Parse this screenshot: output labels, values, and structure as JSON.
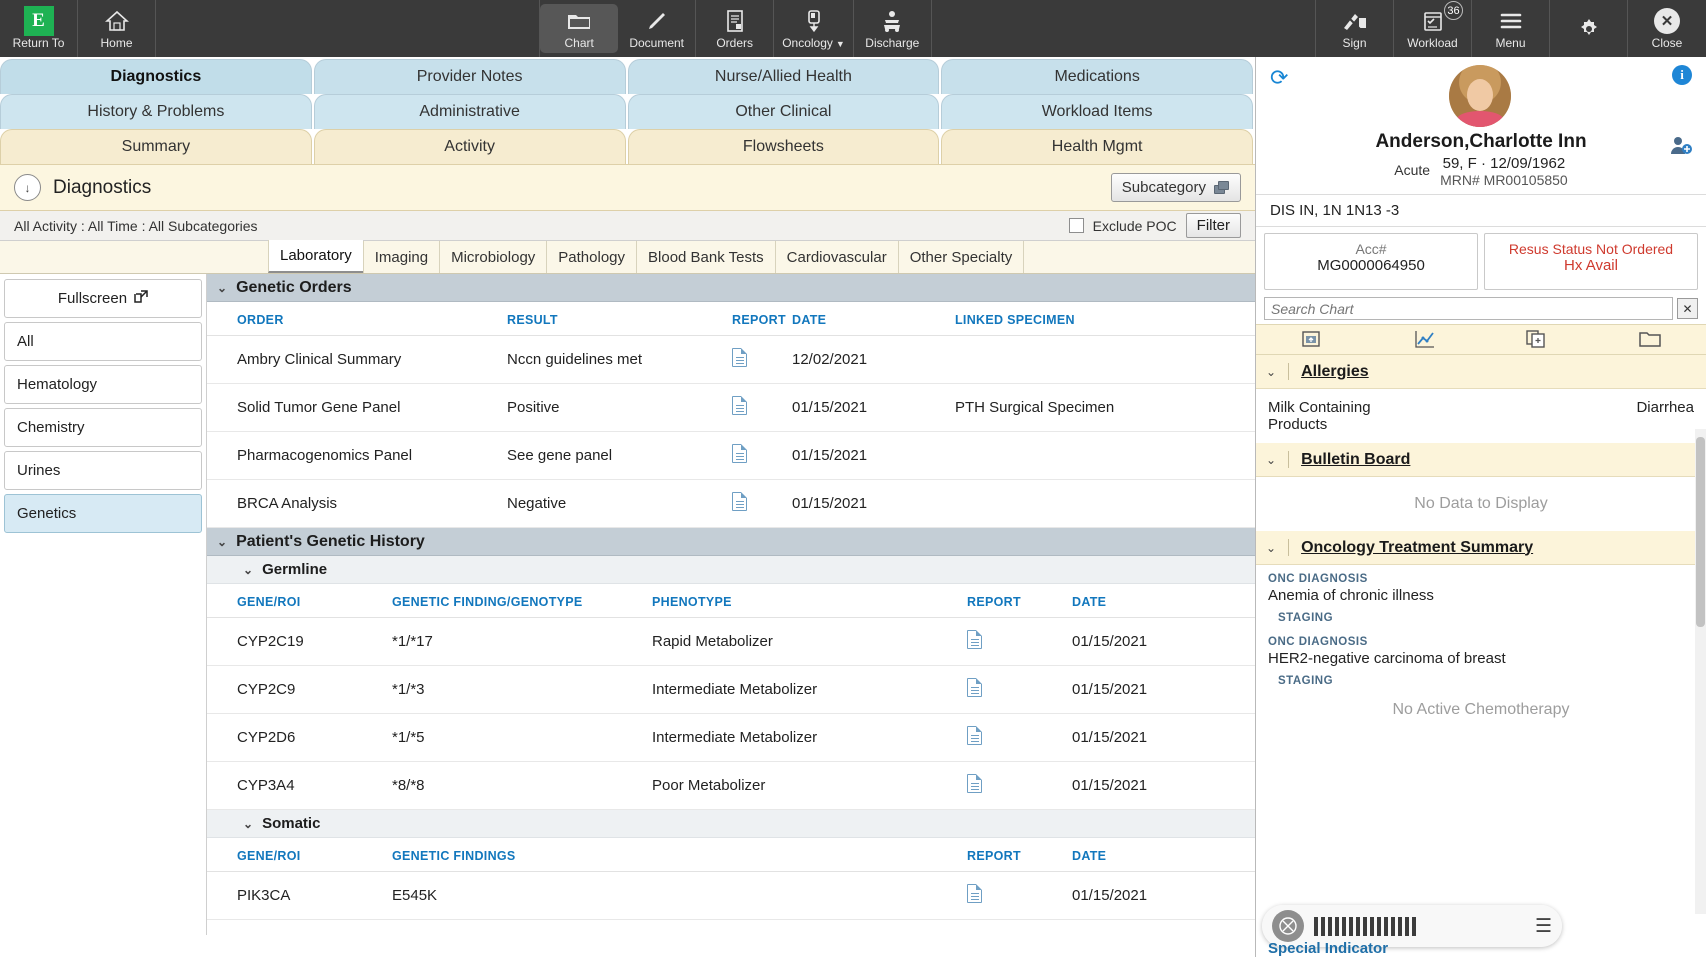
{
  "toolbar": {
    "logo_letter": "E",
    "items": [
      {
        "label": "Return To",
        "icon": "logo-icon"
      },
      {
        "label": "Home",
        "icon": "home-icon"
      },
      {
        "label": "Chart",
        "icon": "folder-icon",
        "active": true
      },
      {
        "label": "Document",
        "icon": "pencil-icon"
      },
      {
        "label": "Orders",
        "icon": "clipboard-icon"
      },
      {
        "label": "Oncology",
        "icon": "iv-bag-icon",
        "caret": true
      },
      {
        "label": "Discharge",
        "icon": "car-icon"
      },
      {
        "label": "Sign",
        "icon": "sign-icon"
      },
      {
        "label": "Workload",
        "icon": "calendar-check-icon",
        "badge": "36"
      },
      {
        "label": "Menu",
        "icon": "hamburger-icon"
      },
      {
        "label": "",
        "icon": "gear-icon"
      },
      {
        "label": "Close",
        "icon": "close-icon"
      }
    ]
  },
  "chart_tabs": {
    "row1": [
      "Diagnostics",
      "Provider Notes",
      "Nurse/Allied Health",
      "Medications"
    ],
    "row2": [
      "History & Problems",
      "Administrative",
      "Other Clinical",
      "Workload Items"
    ],
    "row3": [
      "Summary",
      "Activity",
      "Flowsheets",
      "Health Mgmt"
    ],
    "selected": "Diagnostics"
  },
  "diagnostics": {
    "title": "Diagnostics",
    "subcategory_button": "Subcategory",
    "filter_text": "All Activity  :  All Time  :  All Subcategories",
    "exclude_poc_label": "Exclude POC",
    "filter_button": "Filter"
  },
  "lab_subtabs": {
    "items": [
      "Laboratory",
      "Imaging",
      "Microbiology",
      "Pathology",
      "Blood Bank Tests",
      "Cardiovascular",
      "Other Specialty"
    ],
    "selected": "Laboratory"
  },
  "left_sidebar": {
    "fullscreen_label": "Fullscreen",
    "items": [
      "All",
      "Hematology",
      "Chemistry",
      "Urines",
      "Genetics"
    ],
    "selected": "Genetics"
  },
  "genetic_orders": {
    "section_title": "Genetic Orders",
    "columns": [
      "ORDER",
      "RESULT",
      "REPORT",
      "DATE",
      "LINKED SPECIMEN"
    ],
    "rows": [
      {
        "order": "Ambry Clinical Summary",
        "result": "Nccn guidelines met",
        "report": "document-icon",
        "date": "12/02/2021",
        "linked_specimen": ""
      },
      {
        "order": "Solid Tumor Gene Panel",
        "result": "Positive",
        "report": "document-icon",
        "date": "01/15/2021",
        "linked_specimen": "PTH Surgical Specimen"
      },
      {
        "order": "Pharmacogenomics Panel",
        "result": "See gene panel",
        "report": "document-icon",
        "date": "01/15/2021",
        "linked_specimen": ""
      },
      {
        "order": "BRCA Analysis",
        "result": "Negative",
        "report": "document-icon",
        "date": "01/15/2021",
        "linked_specimen": ""
      }
    ]
  },
  "genetic_history": {
    "section_title": "Patient's Genetic History",
    "germline": {
      "title": "Germline",
      "columns": [
        "GENE/ROI",
        "GENETIC FINDING/GENOTYPE",
        "PHENOTYPE",
        "REPORT",
        "DATE"
      ],
      "rows": [
        {
          "gene": "CYP2C19",
          "finding": "*1/*17",
          "phenotype": "Rapid Metabolizer",
          "report": "document-icon",
          "date": "01/15/2021"
        },
        {
          "gene": "CYP2C9",
          "finding": "*1/*3",
          "phenotype": "Intermediate Metabolizer",
          "report": "document-icon",
          "date": "01/15/2021"
        },
        {
          "gene": "CYP2D6",
          "finding": "*1/*5",
          "phenotype": "Intermediate Metabolizer",
          "report": "document-icon",
          "date": "01/15/2021"
        },
        {
          "gene": "CYP3A4",
          "finding": "*8/*8",
          "phenotype": "Poor Metabolizer",
          "report": "document-icon",
          "date": "01/15/2021"
        }
      ]
    },
    "somatic": {
      "title": "Somatic",
      "columns": [
        "GENE/ROI",
        "GENETIC FINDINGS",
        "REPORT",
        "DATE"
      ],
      "rows": [
        {
          "gene": "PIK3CA",
          "finding": "E545K",
          "report": "document-icon",
          "date": "01/15/2021"
        }
      ]
    }
  },
  "patient": {
    "name": "Anderson,Charlotte Inn",
    "acute_label": "Acute",
    "demographics": "59, F · 12/09/1962",
    "mrn": "MRN# MR00105850",
    "location": "DIS IN, 1N  1N13 -3",
    "acc_label": "Acc#",
    "acc_value": "MG0000064950",
    "resus_status": "Resus Status Not Ordered",
    "hx_avail": "Hx Avail"
  },
  "chart_search": {
    "placeholder": "Search Chart",
    "tools": [
      "upload-icon",
      "trend-chart-icon",
      "copy-clipboard-icon",
      "folder-icon"
    ]
  },
  "right_sections": [
    {
      "title": "Allergies",
      "type": "allergies",
      "rows": [
        {
          "name": "Milk Containing Products",
          "reaction": "Diarrhea"
        }
      ]
    },
    {
      "title": "Bulletin Board",
      "type": "empty",
      "empty_text": "No Data to Display"
    },
    {
      "title": "Oncology Treatment Summary",
      "type": "oncology",
      "entries": [
        {
          "label": "ONC DIAGNOSIS",
          "value": "Anemia of chronic illness",
          "sub": "STAGING"
        },
        {
          "label": "ONC DIAGNOSIS",
          "value": "HER2-negative carcinoma of breast",
          "sub": "STAGING"
        }
      ],
      "footer": "No Active Chemotherapy"
    },
    {
      "title": "Special Indicator",
      "type": "partial"
    }
  ],
  "colors": {
    "toolbar_bg": "#3a3a3a",
    "tab_blue": "#c7e0eb",
    "tab_cream": "#f6ecd0",
    "accent_blue": "#1277bd",
    "alert_red": "#cf3a2e",
    "section_header": "#c4ced6",
    "panel_cream": "#fcf4da"
  }
}
